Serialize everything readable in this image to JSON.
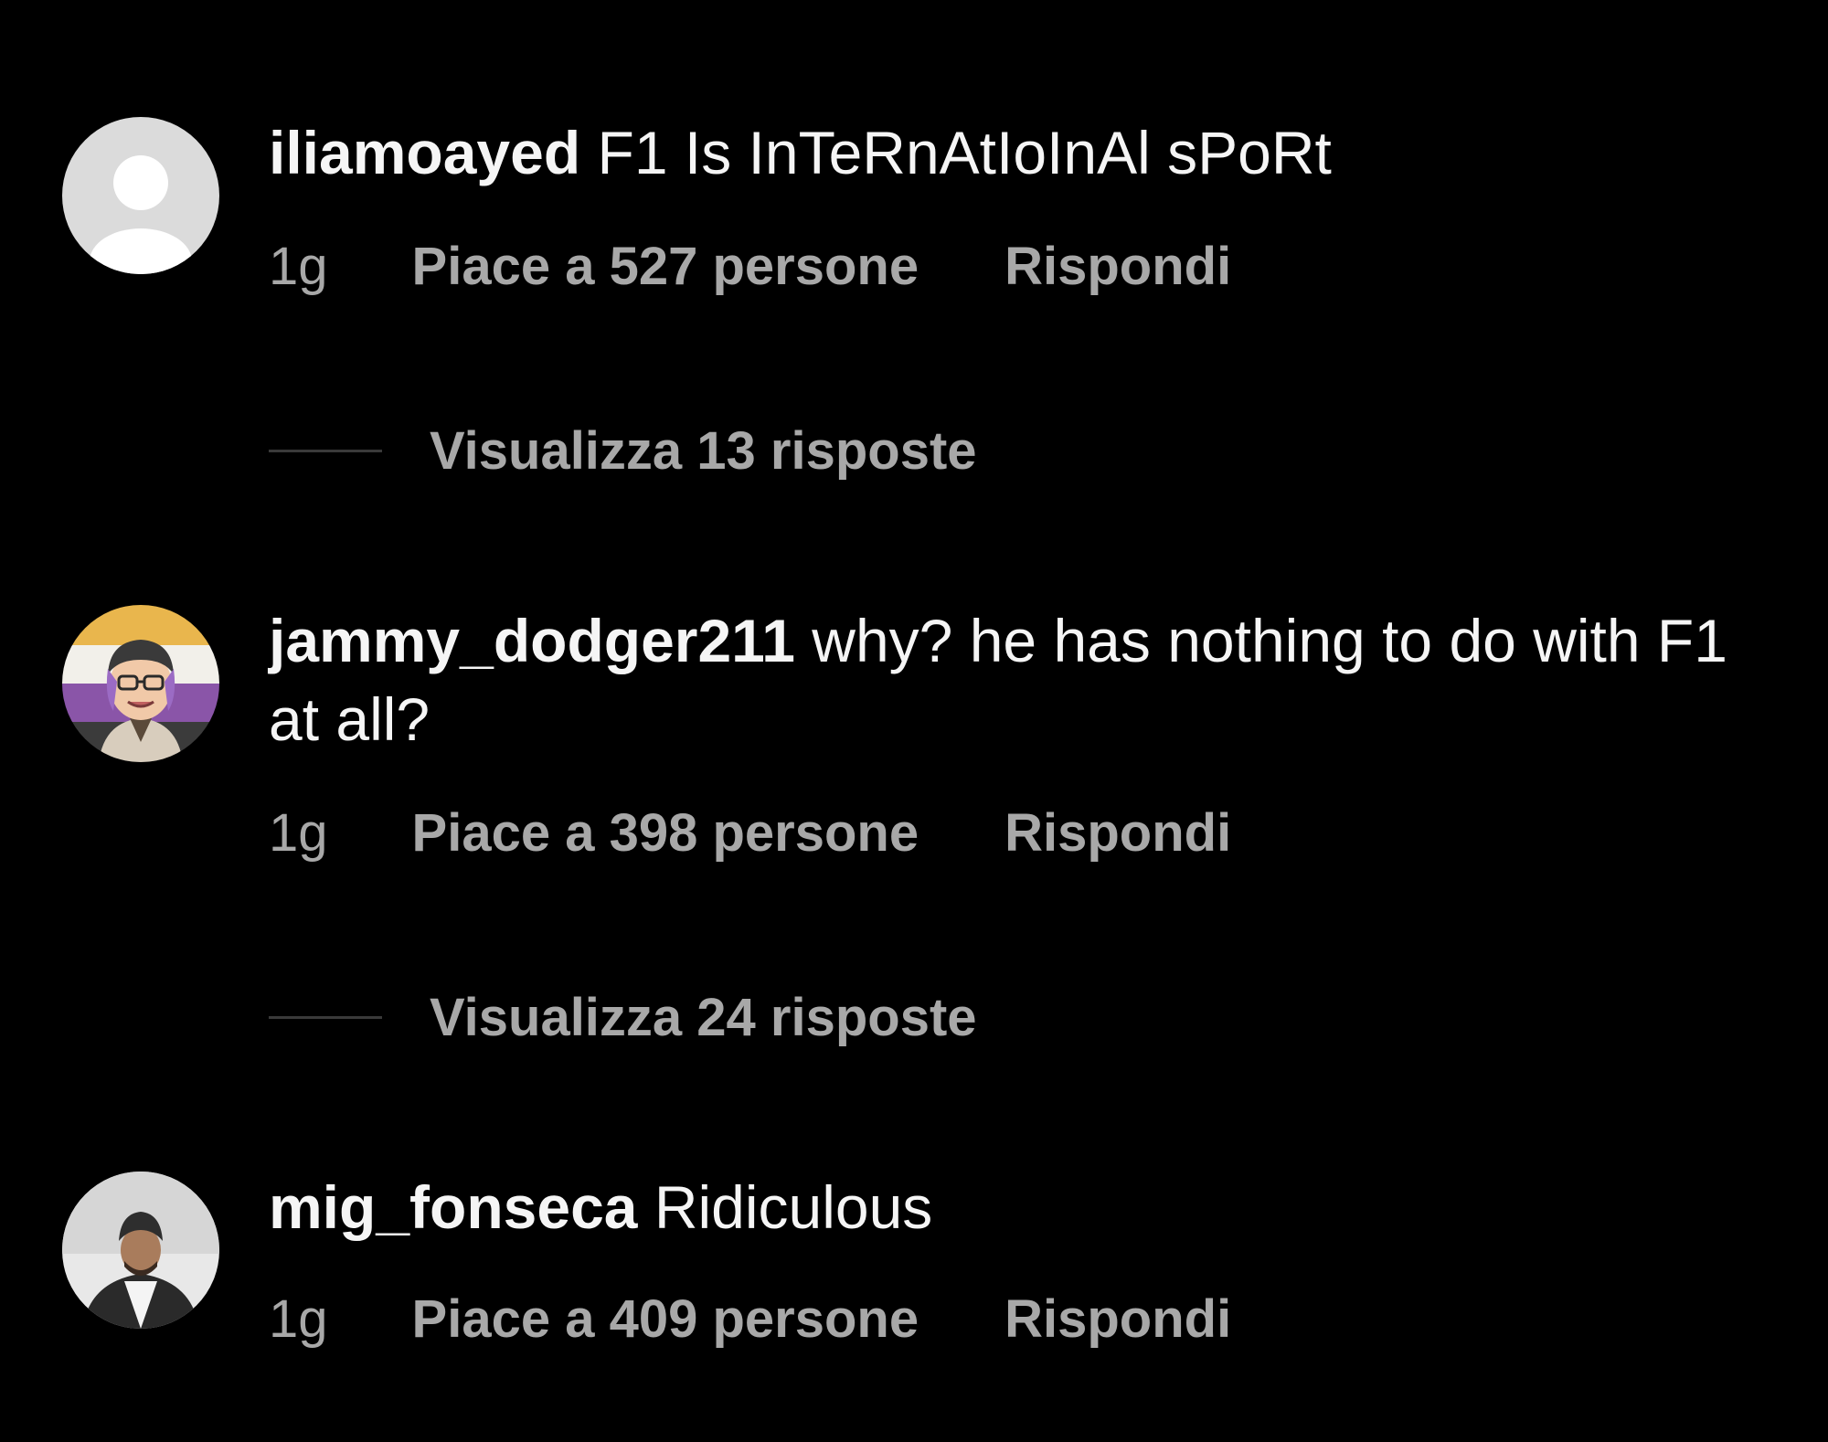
{
  "comments": [
    {
      "username": "iliamoayed",
      "text": "F1 Is InTeRnAtIoInAl sPoRt",
      "time": "1g",
      "likes": "Piace a 527 persone",
      "reply": "Rispondi",
      "view_replies": "Visualizza 13 risposte",
      "avatar_icon": "default-profile-icon"
    },
    {
      "username": "jammy_dodger211",
      "text": "why? he has nothing to do with F1 at all?",
      "time": "1g",
      "likes": "Piace a 398 persone",
      "reply": "Rispondi",
      "view_replies": "Visualizza 24 risposte",
      "avatar_icon": "cartoon-avatar-icon"
    },
    {
      "username": "mig_fonseca",
      "text": "Ridiculous",
      "time": "1g",
      "likes": "Piace a 409 persone",
      "reply": "Rispondi",
      "avatar_icon": "photo-avatar-icon"
    }
  ],
  "colors": {
    "background": "#000000",
    "primary_text": "#f5f5f5",
    "secondary_text": "#a8a8a8",
    "divider": "#3a3a3a"
  }
}
